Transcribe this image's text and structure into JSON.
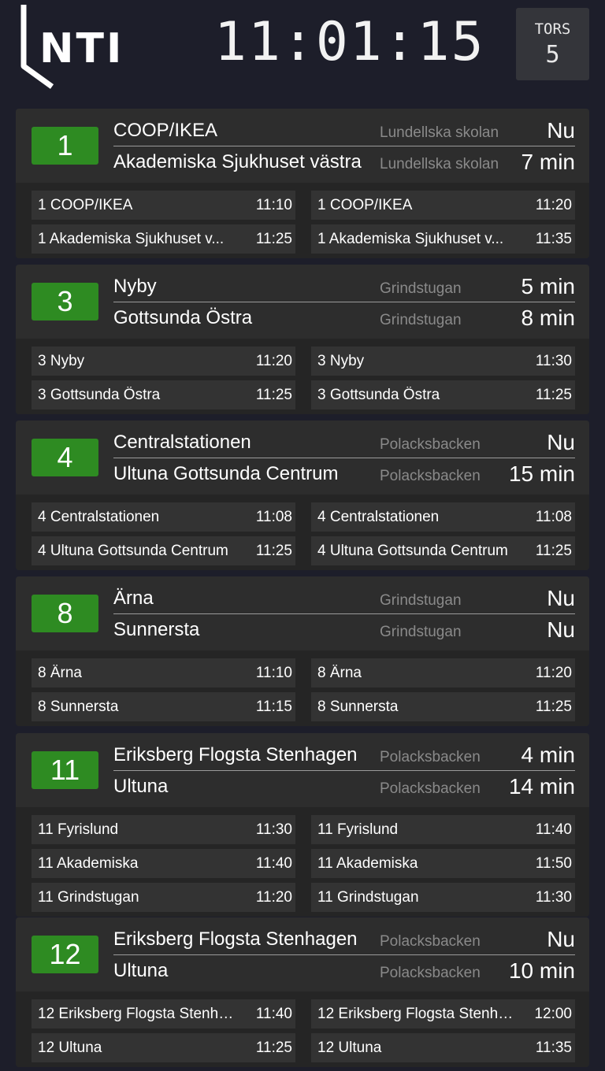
{
  "header": {
    "logo_text": "NTI",
    "clock": "11:01:15",
    "date": {
      "weekday": "TORS",
      "day": "5"
    }
  },
  "lines": [
    {
      "number": "1",
      "departures": [
        {
          "destination": "COOP/IKEA",
          "stop": "Lundellska skolan",
          "eta": "Nu"
        },
        {
          "destination": "Akademiska Sjukhuset västra",
          "stop": "Lundellska skolan",
          "eta": "7 min"
        }
      ],
      "upcoming": [
        [
          {
            "name": "1 COOP/IKEA",
            "time": "11:10"
          },
          {
            "name": "1 COOP/IKEA",
            "time": "11:20"
          }
        ],
        [
          {
            "name": "1 Akademiska Sjukhuset v...",
            "time": "11:25"
          },
          {
            "name": "1 Akademiska Sjukhuset v...",
            "time": "11:35"
          }
        ]
      ]
    },
    {
      "number": "3",
      "departures": [
        {
          "destination": "Nyby",
          "stop": "Grindstugan",
          "eta": "5 min"
        },
        {
          "destination": "Gottsunda Östra",
          "stop": "Grindstugan",
          "eta": "8 min"
        }
      ],
      "upcoming": [
        [
          {
            "name": "3 Nyby",
            "time": "11:20"
          },
          {
            "name": "3 Nyby",
            "time": "11:30"
          }
        ],
        [
          {
            "name": "3 Gottsunda Östra",
            "time": "11:25"
          },
          {
            "name": "3 Gottsunda Östra",
            "time": "11:25"
          }
        ]
      ]
    },
    {
      "number": "4",
      "departures": [
        {
          "destination": "Centralstationen",
          "stop": "Polacksbacken",
          "eta": "Nu"
        },
        {
          "destination": "Ultuna Gottsunda Centrum",
          "stop": "Polacksbacken",
          "eta": "15 min"
        }
      ],
      "upcoming": [
        [
          {
            "name": "4 Centralstationen",
            "time": "11:08"
          },
          {
            "name": "4 Centralstationen",
            "time": "11:08"
          }
        ],
        [
          {
            "name": "4 Ultuna Gottsunda Centrum",
            "time": "11:25"
          },
          {
            "name": "4 Ultuna Gottsunda Centrum",
            "time": "11:25"
          }
        ]
      ]
    },
    {
      "number": "8",
      "departures": [
        {
          "destination": "Ärna",
          "stop": "Grindstugan",
          "eta": "Nu"
        },
        {
          "destination": "Sunnersta",
          "stop": "Grindstugan",
          "eta": "Nu"
        }
      ],
      "upcoming": [
        [
          {
            "name": "8 Ärna",
            "time": "11:10"
          },
          {
            "name": "8 Ärna",
            "time": "11:20"
          }
        ],
        [
          {
            "name": "8 Sunnersta",
            "time": "11:15"
          },
          {
            "name": "8 Sunnersta",
            "time": "11:25"
          }
        ]
      ]
    },
    {
      "number": "11",
      "departures": [
        {
          "destination": "Eriksberg Flogsta Stenhagen",
          "stop": "Polacksbacken",
          "eta": "4 min"
        },
        {
          "destination": "Ultuna",
          "stop": "Polacksbacken",
          "eta": "14 min"
        }
      ],
      "upcoming": [
        [
          {
            "name": "11 Fyrislund",
            "time": "11:30"
          },
          {
            "name": "11 Fyrislund",
            "time": "11:40"
          }
        ],
        [
          {
            "name": "11 Akademiska",
            "time": "11:40"
          },
          {
            "name": "11 Akademiska",
            "time": "11:50"
          }
        ],
        [
          {
            "name": "11 Grindstugan",
            "time": "11:20"
          },
          {
            "name": "11 Grindstugan",
            "time": "11:30"
          }
        ]
      ]
    },
    {
      "number": "12",
      "departures": [
        {
          "destination": "Eriksberg Flogsta Stenhagen",
          "stop": "Polacksbacken",
          "eta": "Nu"
        },
        {
          "destination": "Ultuna",
          "stop": "Polacksbacken",
          "eta": "10 min"
        }
      ],
      "upcoming": [
        [
          {
            "name": "12 Eriksberg Flogsta Stenha...",
            "time": "11:40"
          },
          {
            "name": "12 Eriksberg Flogsta Stenha...",
            "time": "12:00"
          }
        ],
        [
          {
            "name": "12 Ultuna",
            "time": "11:25"
          },
          {
            "name": "12 Ultuna",
            "time": "11:35"
          }
        ]
      ]
    }
  ],
  "colors": {
    "background": "#1d1e2a",
    "card": "#2b2b2b",
    "line_badge": "#2e8b22",
    "stop_text": "#8a8a8a"
  }
}
